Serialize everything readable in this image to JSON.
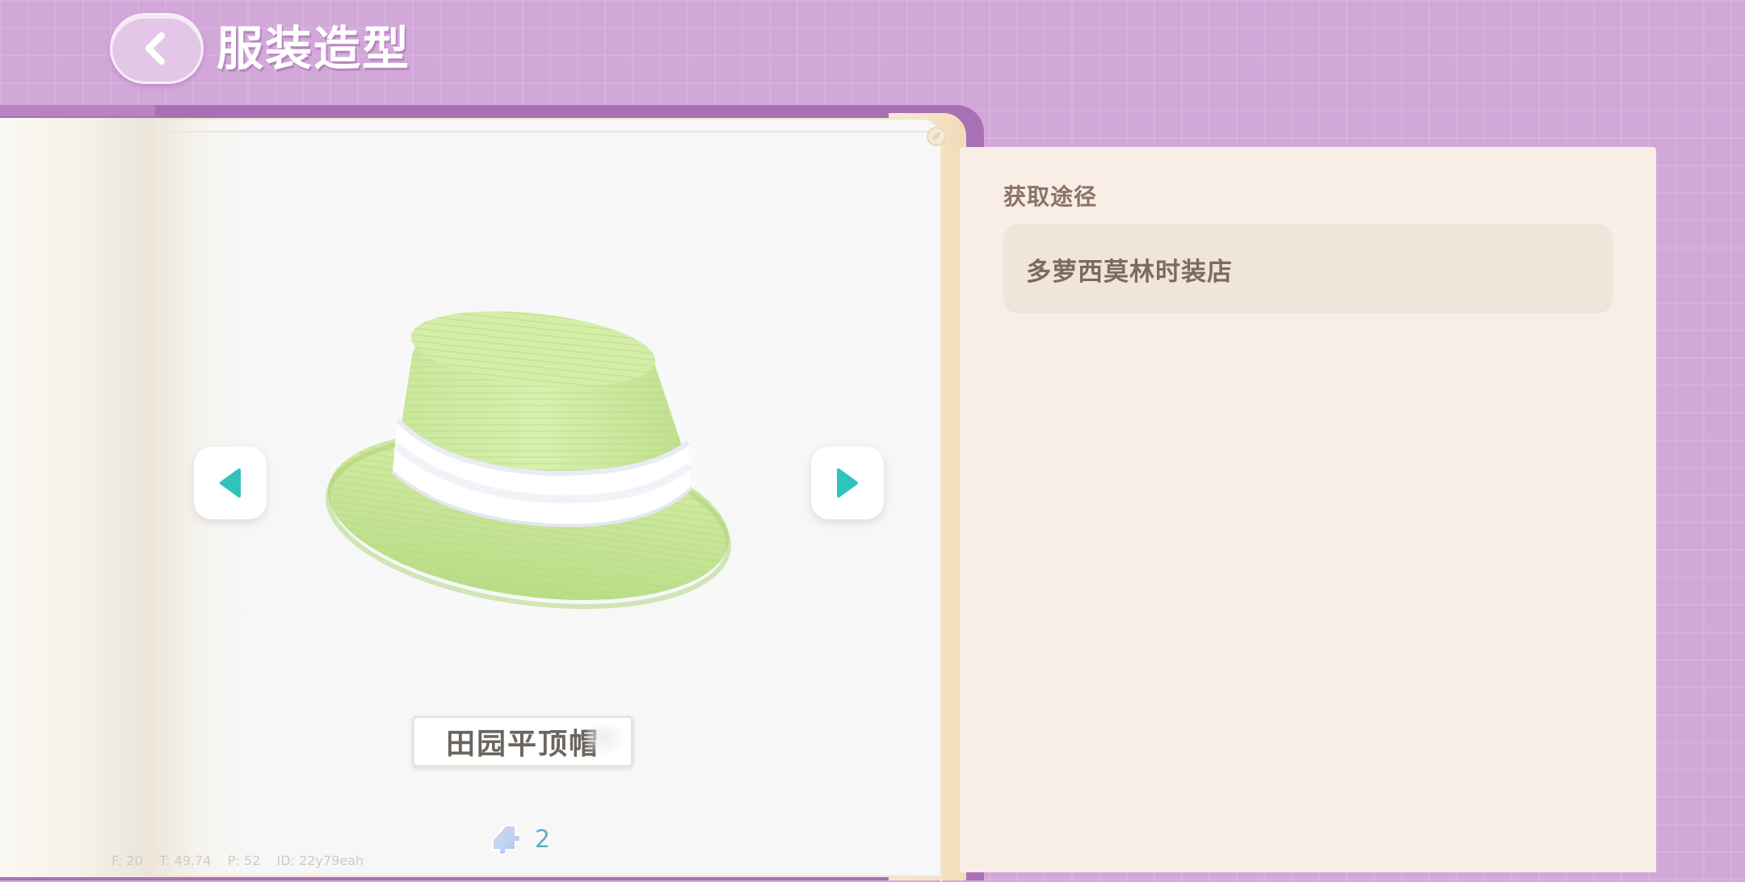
{
  "header": {
    "back_icon": "chevron-left-icon",
    "title": "服装造型"
  },
  "item": {
    "name": "田园平顶帽",
    "image": "green-boater-hat-with-white-band",
    "fragment_icon": "fragment-icon",
    "fragment_count": "2",
    "prev_icon": "triangle-left-icon",
    "next_icon": "triangle-right-icon",
    "arrow_color": "#2ec4bc"
  },
  "source": {
    "heading": "获取途径",
    "entries": [
      {
        "label": "多萝西莫林时装店"
      }
    ]
  },
  "debug": {
    "text": "F: 20    T: 49.74    P: 52    ID: 22y79eah"
  },
  "colors": {
    "background": "#d2a8d9",
    "book_cover": "#a970b6",
    "page": "#f7f7f7",
    "panel": "#f8eee6",
    "card": "#f0e5db"
  }
}
